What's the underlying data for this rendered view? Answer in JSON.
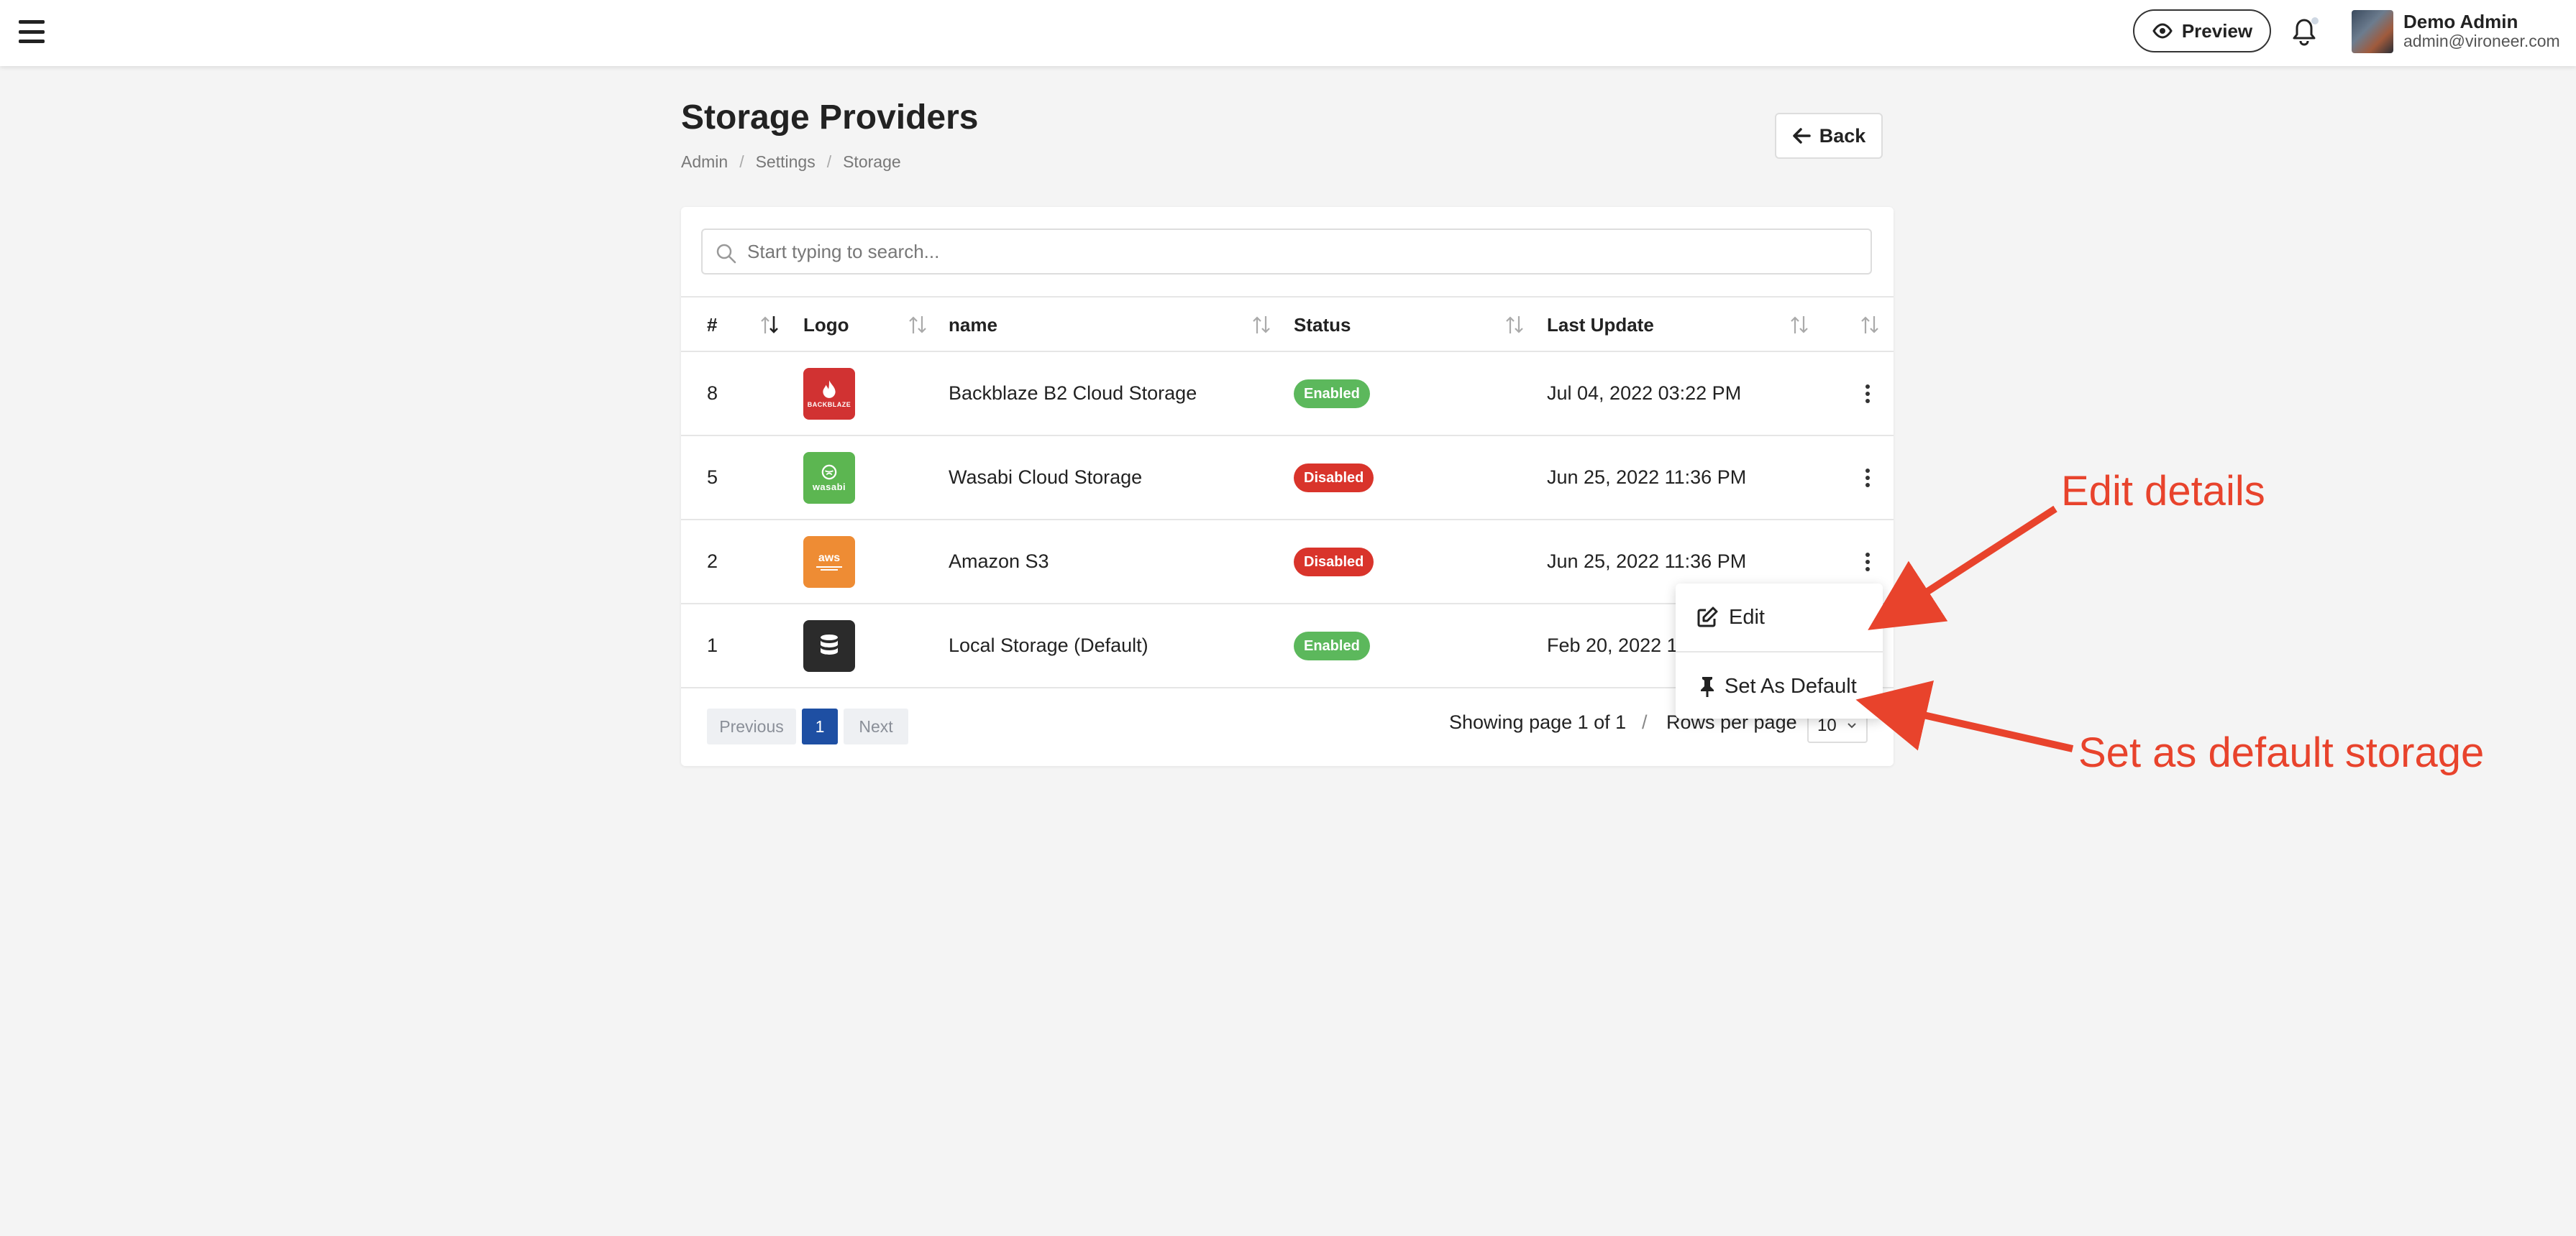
{
  "header": {
    "preview_label": "Preview",
    "user_name": "Demo Admin",
    "user_email": "admin@vironeer.com"
  },
  "page": {
    "title": "Storage Providers",
    "breadcrumb": [
      "Admin",
      "Settings",
      "Storage"
    ],
    "back_label": "Back"
  },
  "search": {
    "placeholder": "Start typing to search..."
  },
  "table": {
    "columns": [
      "#",
      "Logo",
      "name",
      "Status",
      "Last Update"
    ],
    "rows": [
      {
        "id": "8",
        "logo": "backblaze-logo",
        "logo_text": "BACKBLAZE",
        "name": "Backblaze B2 Cloud Storage",
        "status": "Enabled",
        "last_update": "Jul 04, 2022 03:22 PM"
      },
      {
        "id": "5",
        "logo": "wasabi-logo",
        "logo_text": "wasabi",
        "name": "Wasabi Cloud Storage",
        "status": "Disabled",
        "last_update": "Jun 25, 2022 11:36 PM"
      },
      {
        "id": "2",
        "logo": "amazon-s3-logo",
        "logo_text": "aws",
        "name": "Amazon S3",
        "status": "Disabled",
        "last_update": "Jun 25, 2022 11:36 PM"
      },
      {
        "id": "1",
        "logo": "database-logo",
        "logo_text": "",
        "name": "Local Storage (Default)",
        "status": "Enabled",
        "last_update": "Feb 20, 2022 11"
      }
    ]
  },
  "pagination": {
    "previous_label": "Previous",
    "current_page": "1",
    "next_label": "Next",
    "page_info": "Showing page 1 of 1",
    "separator": "/",
    "rows_per_page_label": "Rows per page",
    "rows_per_page_value": "10"
  },
  "dropdown": {
    "edit_label": "Edit",
    "set_default_label": "Set As Default"
  },
  "annotations": {
    "edit_details": "Edit details",
    "set_default_storage": "Set as default storage"
  },
  "colors": {
    "enabled": "#5cb85c",
    "disabled": "#d9342b",
    "active_page": "#1e4fa3",
    "annotation": "#e8432c",
    "backblaze": "#d13232",
    "wasabi": "#5cb651",
    "amazon": "#ee8c34",
    "local": "#2b2b2b"
  }
}
